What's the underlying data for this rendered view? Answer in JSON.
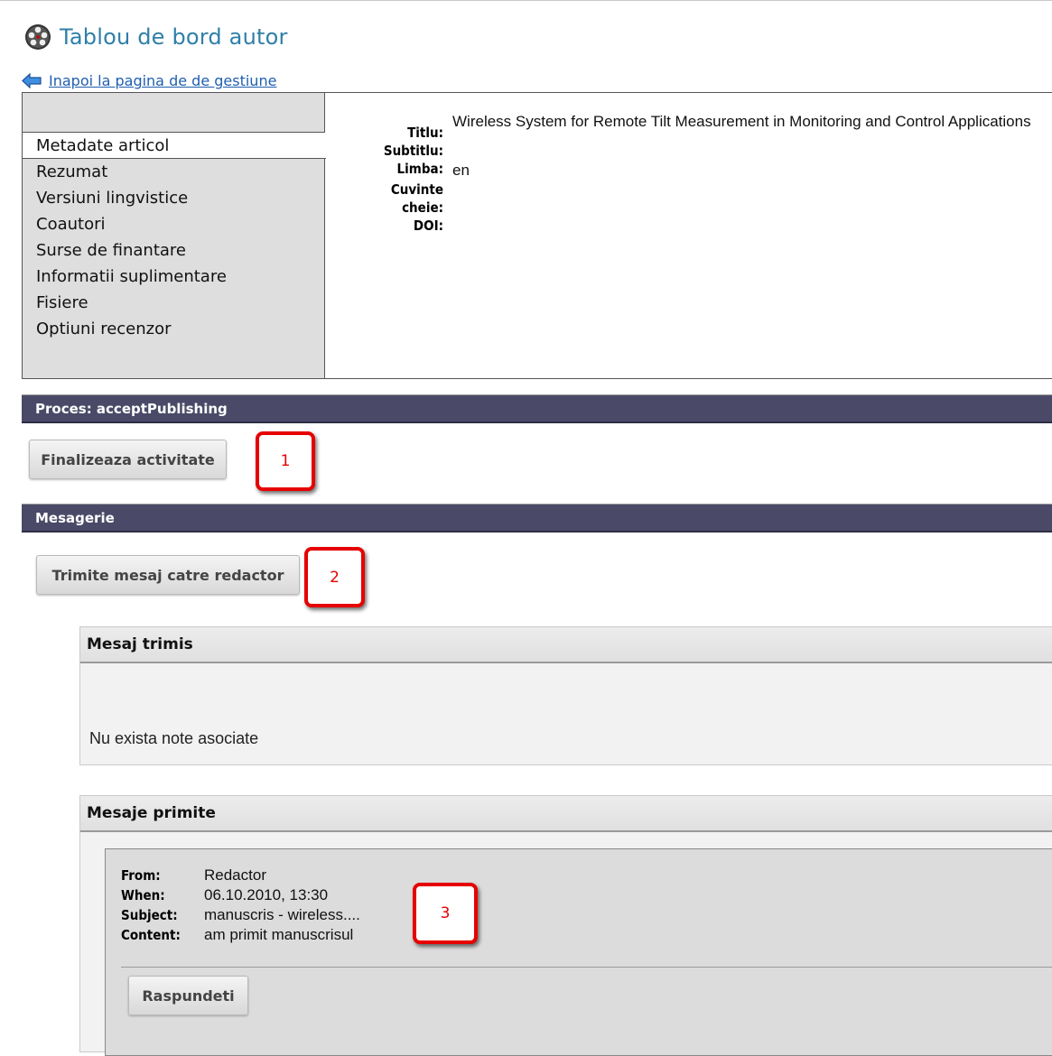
{
  "page": {
    "title": "Tablou de bord autor",
    "back_link": "Inapoi la pagina de de gestiune"
  },
  "tabs": [
    {
      "label": "Metadate articol",
      "active": true
    },
    {
      "label": "Rezumat"
    },
    {
      "label": "Versiuni lingvistice"
    },
    {
      "label": "Coautori"
    },
    {
      "label": "Surse de finantare"
    },
    {
      "label": "Informatii suplimentare"
    },
    {
      "label": "Fisiere"
    },
    {
      "label": "Optiuni recenzor"
    }
  ],
  "metadata": {
    "title_label": "Titlu:",
    "title_value": "Wireless System for Remote Tilt Measurement in Monitoring and Control Applications",
    "subtitle_label": "Subtitlu:",
    "subtitle_value": "",
    "language_label": "Limba:",
    "language_value": "en",
    "keywords_label_1": "Cuvinte",
    "keywords_label_2": "cheie:",
    "keywords_value": "",
    "doi_label": "DOI:",
    "doi_value": ""
  },
  "process": {
    "header": "Proces: acceptPublishing",
    "finalize_button": "Finalizeaza activitate"
  },
  "messaging": {
    "header": "Mesagerie",
    "send_button": "Trimite mesaj catre redactor",
    "sent_header": "Mesaj trimis",
    "sent_empty": "Nu exista note asociate",
    "received_header": "Mesaje primite",
    "message": {
      "from_label": "From:",
      "from_value": "Redactor",
      "when_label": "When:",
      "when_value": "06.10.2010, 13:30",
      "subject_label": "Subject:",
      "subject_value": "manuscris - wireless....",
      "content_label": "Content:",
      "content_value": "am primit manuscrisul"
    },
    "reply_button": "Raspundeti"
  },
  "markers": [
    "1",
    "2",
    "3"
  ],
  "colors": {
    "title": "#2f7fa8",
    "link": "#1f5fb0",
    "section_bar": "#4a4a68",
    "marker": "#e60000"
  },
  "icons": {
    "title_icon": "film-reel-icon",
    "back_icon": "arrow-left-icon"
  }
}
